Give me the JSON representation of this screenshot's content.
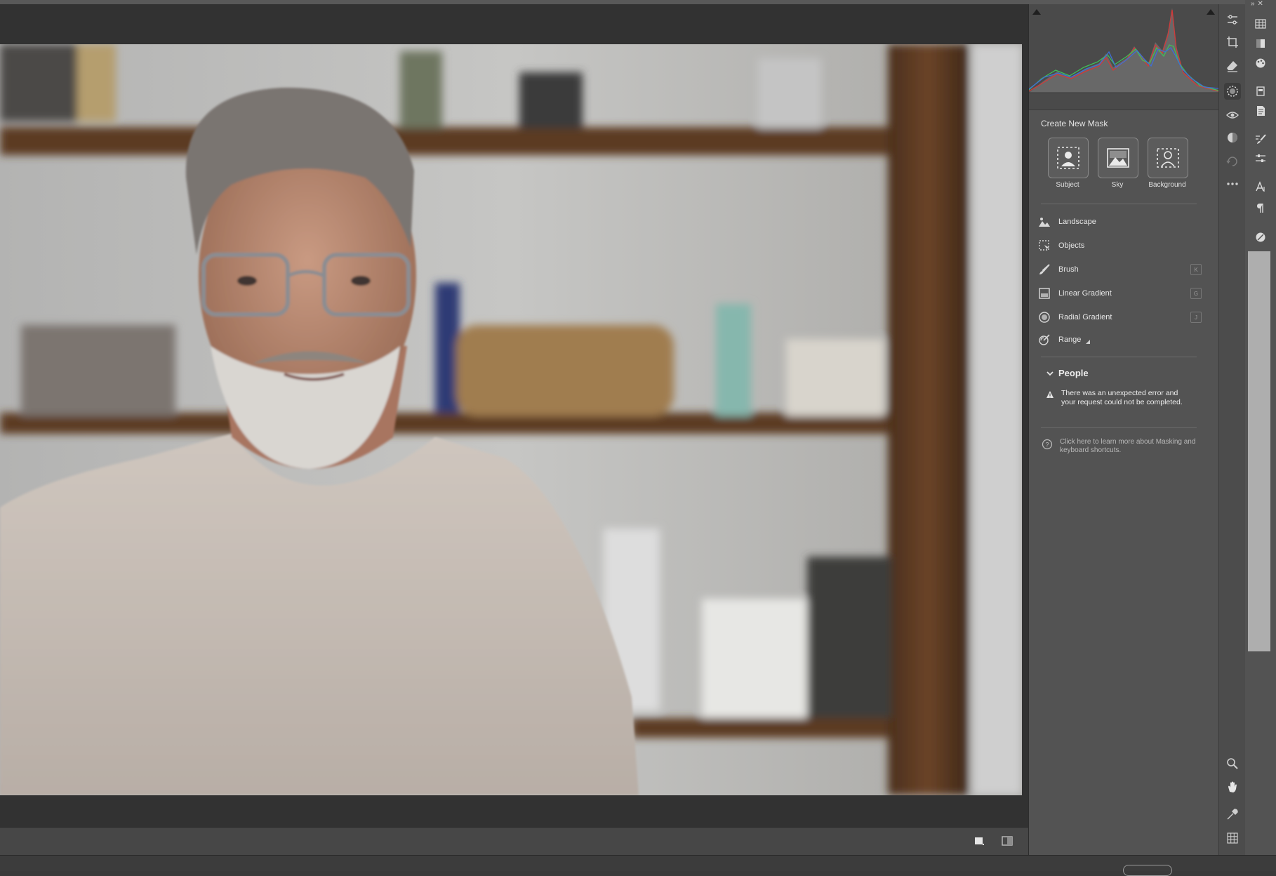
{
  "mask_panel": {
    "title": "Create New Mask",
    "quick_masks": [
      {
        "label": "Subject",
        "icon": "person-icon"
      },
      {
        "label": "Sky",
        "icon": "sky-icon"
      },
      {
        "label": "Background",
        "icon": "background-icon"
      }
    ],
    "tools": [
      {
        "label": "Landscape",
        "icon": "landscape-icon",
        "shortcut": ""
      },
      {
        "label": "Objects",
        "icon": "objects-icon",
        "shortcut": ""
      },
      {
        "label": "Brush",
        "icon": "brush-icon",
        "shortcut": "K"
      },
      {
        "label": "Linear Gradient",
        "icon": "linear-gradient-icon",
        "shortcut": "G"
      },
      {
        "label": "Radial Gradient",
        "icon": "radial-gradient-icon",
        "shortcut": "J"
      },
      {
        "label": "Range",
        "icon": "range-icon",
        "shortcut": ""
      }
    ],
    "people": {
      "label": "People",
      "error": "There was an unexpected error and your request could not be completed."
    },
    "help": "Click here to learn more about Masking and keyboard shortcuts."
  },
  "colors": {
    "panel_bg": "#535353",
    "canvas_bg": "#323232",
    "histogram_red": "#d13a3a",
    "histogram_green": "#3fbf58",
    "histogram_blue": "#3f6fd6"
  }
}
